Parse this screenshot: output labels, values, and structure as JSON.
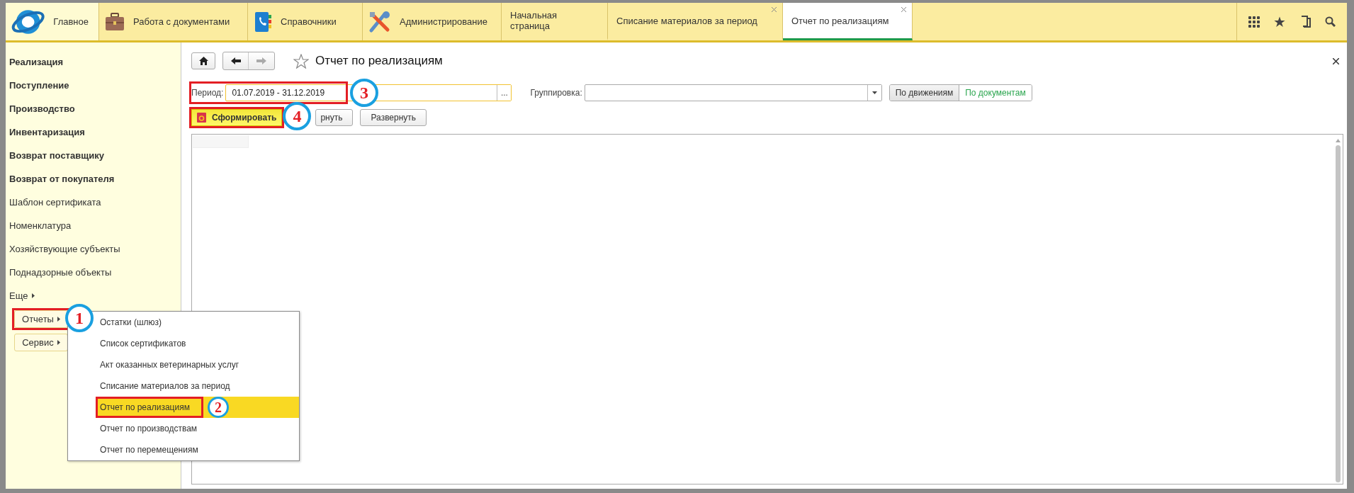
{
  "top_nav": {
    "sections": [
      {
        "label": "Главное",
        "selected": true
      },
      {
        "label": "Работа с документами",
        "selected": false
      },
      {
        "label": "Справочники",
        "selected": false
      },
      {
        "label": "Администрирование",
        "selected": false
      }
    ],
    "open_tabs": [
      {
        "label": "Начальная страница",
        "selected": false,
        "closable": false
      },
      {
        "label": "Списание материалов за период",
        "selected": false,
        "closable": true
      },
      {
        "label": "Отчет по реализациям",
        "selected": true,
        "closable": true
      }
    ]
  },
  "sidebar": {
    "items": [
      {
        "label": "Реализация",
        "kind": "section"
      },
      {
        "label": "Поступление",
        "kind": "section"
      },
      {
        "label": "Производство",
        "kind": "section"
      },
      {
        "label": "Инвентаризация",
        "kind": "section"
      },
      {
        "label": "Возврат поставщику",
        "kind": "section"
      },
      {
        "label": "Возврат от покупателя",
        "kind": "section"
      },
      {
        "label": "Шаблон сертификата",
        "kind": "link"
      },
      {
        "label": "Номенклатура",
        "kind": "link"
      },
      {
        "label": "Хозяйствующие субъекты",
        "kind": "link"
      },
      {
        "label": "Поднадзорные объекты",
        "kind": "link"
      },
      {
        "label": "Еще",
        "kind": "more"
      },
      {
        "label": "Отчеты",
        "kind": "button",
        "callout": "1"
      },
      {
        "label": "Сервис",
        "kind": "button"
      }
    ]
  },
  "popup_menu": {
    "items": [
      {
        "label": "Остатки (шлюз)",
        "selected": false
      },
      {
        "label": "Список сертификатов",
        "selected": false
      },
      {
        "label": "Акт оказанных ветеринарных услуг",
        "selected": false
      },
      {
        "label": "Списание материалов за период",
        "selected": false
      },
      {
        "label": "Отчет по реализациям",
        "selected": true,
        "callout": "2"
      },
      {
        "label": "Отчет по производствам",
        "selected": false
      },
      {
        "label": "Отчет по перемещениям",
        "selected": false
      }
    ]
  },
  "form": {
    "title": "Отчет по реализациям",
    "period": {
      "label": "Период:",
      "value": "01.07.2019 - 31.12.2019",
      "choice_button": "...",
      "callout": "3"
    },
    "grouping": {
      "label": "Группировка:"
    },
    "mode_toggle": [
      {
        "label": "По движениям",
        "selected": true
      },
      {
        "label": "По документам",
        "selected": false
      }
    ],
    "buttons": [
      {
        "label": "Сформировать",
        "kind": "primary",
        "callout": "4"
      },
      {
        "label": "рнуть",
        "kind": "normal"
      },
      {
        "label": "Развернуть",
        "kind": "normal"
      }
    ]
  }
}
